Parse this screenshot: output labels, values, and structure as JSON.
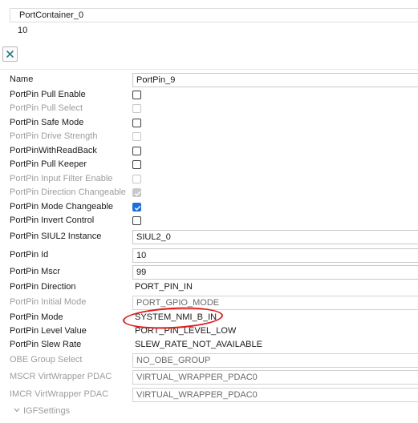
{
  "container": {
    "name": "PortContainer_0",
    "count": "10"
  },
  "toolbar": {
    "close_icon": "close-x-icon"
  },
  "rows": {
    "name": {
      "label": "Name",
      "value": "PortPin_9"
    },
    "pull_enable": {
      "label": "PortPin Pull Enable",
      "checked": false
    },
    "pull_select": {
      "label": "PortPin Pull Select",
      "checked": false
    },
    "safe_mode": {
      "label": "PortPin Safe Mode",
      "checked": false
    },
    "drive_strength": {
      "label": "PortPin Drive Strength",
      "checked": false
    },
    "with_readback": {
      "label": "PortPinWithReadBack",
      "checked": false
    },
    "pull_keeper": {
      "label": "PortPin Pull Keeper",
      "checked": false
    },
    "input_filter": {
      "label": "PortPin Input Filter Enable",
      "checked": false
    },
    "direction_changeable": {
      "label": "PortPin Direction Changeable",
      "checked": true
    },
    "mode_changeable": {
      "label": "PortPin Mode Changeable",
      "checked": true
    },
    "invert_control": {
      "label": "PortPin Invert Control",
      "checked": false
    },
    "siul2_instance": {
      "label": "PortPin SIUL2 Instance",
      "value": "SIUL2_0"
    },
    "pin_id": {
      "label": "PortPin Id",
      "value": "10"
    },
    "mscr": {
      "label": "PortPin Mscr",
      "value": "99"
    },
    "direction": {
      "label": "PortPin Direction",
      "value": "PORT_PIN_IN"
    },
    "initial_mode": {
      "label": "PortPin Initial Mode",
      "value": "PORT_GPIO_MODE"
    },
    "mode": {
      "label": "PortPin Mode",
      "value": "SYSTEM_NMI_B_IN"
    },
    "level_value": {
      "label": "PortPin Level Value",
      "value": "PORT_PIN_LEVEL_LOW"
    },
    "slew_rate": {
      "label": "PortPin Slew Rate",
      "value": "SLEW_RATE_NOT_AVAILABLE"
    },
    "obe_group": {
      "label": "OBE Group Select",
      "value": "NO_OBE_GROUP"
    },
    "mscr_pdac": {
      "label": "MSCR VirtWrapper PDAC",
      "value": "VIRTUAL_WRAPPER_PDAC0"
    },
    "imcr_pdac": {
      "label": "IMCR VirtWrapper PDAC",
      "value": "VIRTUAL_WRAPPER_PDAC0"
    }
  },
  "section": {
    "label": "IGFSettings"
  },
  "colors": {
    "highlight": "#e01b1b",
    "checkbox_checked": "#1f6fd8"
  }
}
